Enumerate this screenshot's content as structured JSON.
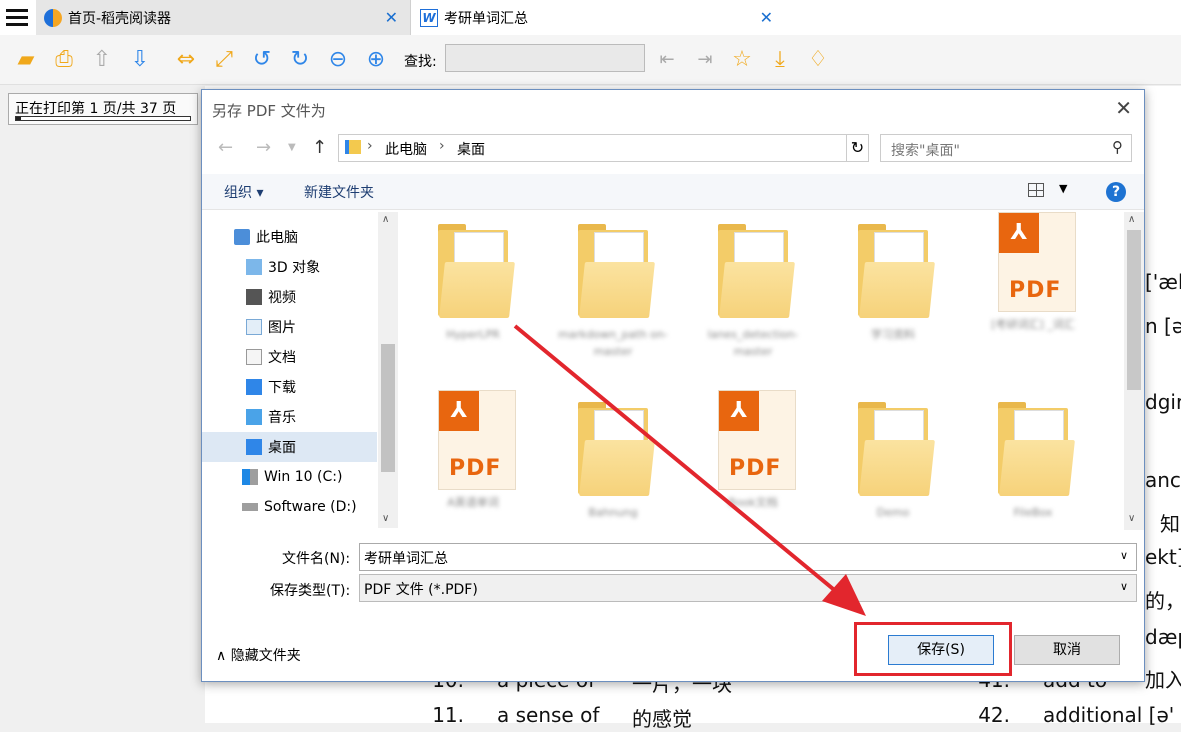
{
  "tabs": [
    {
      "label": "首页-稻壳阅读器",
      "icon": "docer-reader-icon"
    },
    {
      "label": "考研单词汇总",
      "icon": "word-doc-icon"
    }
  ],
  "toolbar": {
    "find_label": "查找:",
    "find_value": ""
  },
  "print_status": {
    "text": "正在打印第 1 页/共 37 页",
    "progress": 0.03
  },
  "document_lines": [
    {
      "text": "['æk"
    },
    {
      "text": "n [ə"
    },
    {
      "text": "dgir"
    },
    {
      "text": "ance"
    },
    {
      "text": "知"
    },
    {
      "text": "ekt]"
    },
    {
      "text": "的，"
    },
    {
      "text": "dæp"
    },
    {
      "text": "加入"
    }
  ],
  "document_rows": [
    {
      "num": "10.",
      "term": "a piece of",
      "meaning": "一片，一块",
      "num2": "41.",
      "term2": "add to",
      "meaning2": "加入"
    },
    {
      "num": "11.",
      "term": "a sense of",
      "meaning": "的感觉",
      "num2": "42.",
      "term2": "additional [ə'"
    }
  ],
  "dialog": {
    "title": "另存 PDF 文件为",
    "breadcrumb": {
      "pc": "此电脑",
      "desktop": "桌面"
    },
    "search_placeholder": "搜索\"桌面\"",
    "organize_label": "组织 ▾",
    "new_folder_label": "新建文件夹",
    "tree": [
      {
        "label": "此电脑",
        "icon": "computer-icon"
      },
      {
        "label": "3D 对象",
        "icon": "3d-objects-icon"
      },
      {
        "label": "视频",
        "icon": "video-icon"
      },
      {
        "label": "图片",
        "icon": "pictures-icon"
      },
      {
        "label": "文档",
        "icon": "documents-icon"
      },
      {
        "label": "下载",
        "icon": "downloads-icon"
      },
      {
        "label": "音乐",
        "icon": "music-icon"
      },
      {
        "label": "桌面",
        "icon": "desktop-icon",
        "selected": true
      },
      {
        "label": "Win 10 (C:)",
        "icon": "drive-c-icon"
      },
      {
        "label": "Software (D:)",
        "icon": "drive-d-icon"
      }
    ],
    "files": [
      {
        "name": "HyperLPR",
        "type": "folder"
      },
      {
        "name": "markdown_path on-master",
        "type": "folder"
      },
      {
        "name": "lanes_detection-master",
        "type": "folder"
      },
      {
        "name": "学习资料",
        "type": "folder"
      },
      {
        "name": "[考研词汇] _词汇",
        "type": "pdf"
      },
      {
        "name": "A英语单词",
        "type": "pdf"
      },
      {
        "name": "Bahnung",
        "type": "folder"
      },
      {
        "name": "Book文档",
        "type": "pdf"
      },
      {
        "name": "Demo",
        "type": "folder"
      },
      {
        "name": "FileBox",
        "type": "folder"
      }
    ],
    "filename_label": "文件名(N):",
    "filename_value": "考研单词汇总",
    "filetype_label": "保存类型(T):",
    "filetype_value": "PDF 文件 (*.PDF)",
    "hide_folders_label": "隐藏文件夹",
    "save_label": "保存(S)",
    "cancel_label": "取消"
  },
  "colors": {
    "accent": "#2f86e8",
    "highlight": "#e2262d",
    "pdf": "#e8660f"
  }
}
